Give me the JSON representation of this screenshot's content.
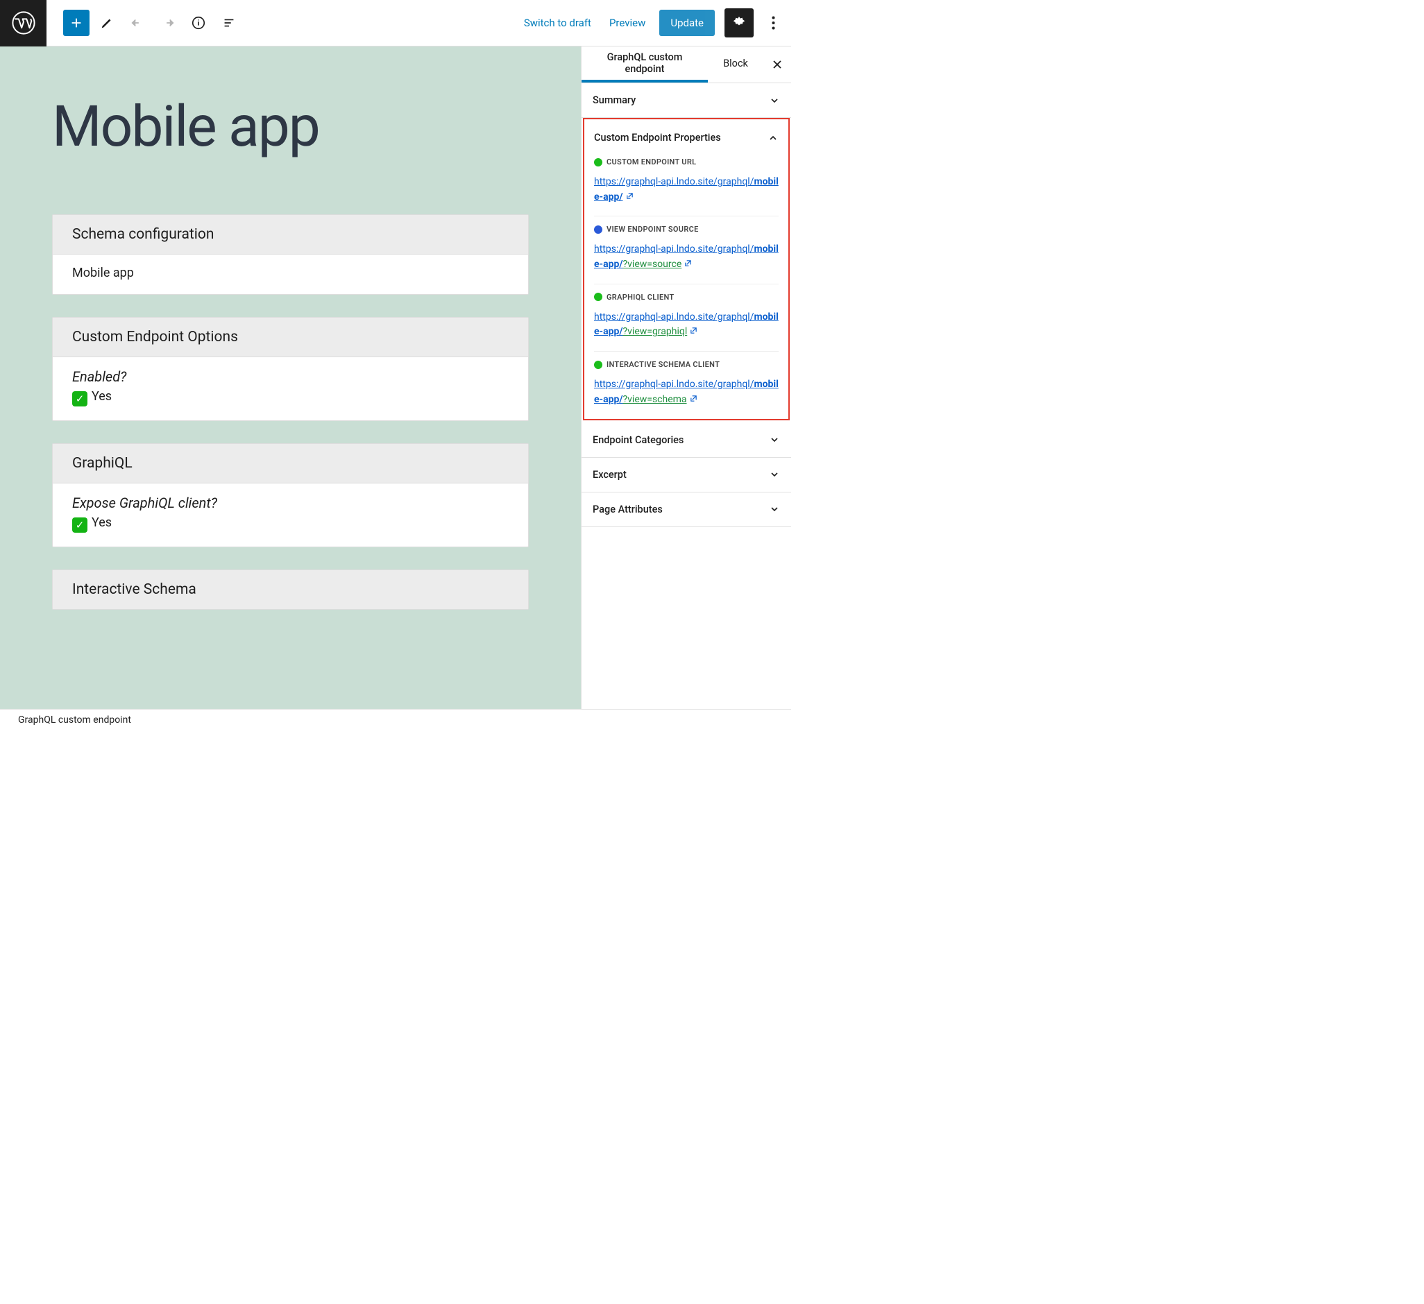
{
  "topbar": {
    "switch_to_draft": "Switch to draft",
    "preview": "Preview",
    "update": "Update"
  },
  "editor": {
    "title": "Mobile app",
    "blocks": {
      "schema_config": {
        "header": "Schema configuration",
        "value": "Mobile app"
      },
      "endpoint_options": {
        "header": "Custom Endpoint Options",
        "question": "Enabled?",
        "answer": "Yes"
      },
      "graphiql": {
        "header": "GraphiQL",
        "question": "Expose GraphiQL client?",
        "answer": "Yes"
      },
      "interactive_schema": {
        "header": "Interactive Schema"
      }
    }
  },
  "sidebar": {
    "tabs": {
      "endpoint": "GraphQL custom endpoint",
      "block": "Block"
    },
    "panels": {
      "summary": "Summary",
      "custom_props": "Custom Endpoint Properties",
      "endpoint_categories": "Endpoint Categories",
      "excerpt": "Excerpt",
      "page_attributes": "Page Attributes"
    },
    "props": {
      "url": {
        "label": "CUSTOM ENDPOINT URL",
        "link_prefix": "https://graphql-api.lndo.site/graphql/",
        "link_slug": "mobile-app/"
      },
      "source": {
        "label": "VIEW ENDPOINT SOURCE",
        "link_prefix": "https://graphql-api.lndo.site/graphql/",
        "link_slug": "mobile-app/",
        "link_query": "?view=source"
      },
      "graphiql": {
        "label": "GRAPHIQL CLIENT",
        "link_prefix": "https://graphql-api.lndo.site/graphql/",
        "link_slug": "mobile-app/",
        "link_query": "?view=graphiql"
      },
      "schema": {
        "label": "INTERACTIVE SCHEMA CLIENT",
        "link_prefix": "https://graphql-api.lndo.site/graphql/",
        "link_slug": "mobile-app/",
        "link_query": "?view=schema"
      }
    }
  },
  "footer": {
    "breadcrumb": "GraphQL custom endpoint"
  }
}
